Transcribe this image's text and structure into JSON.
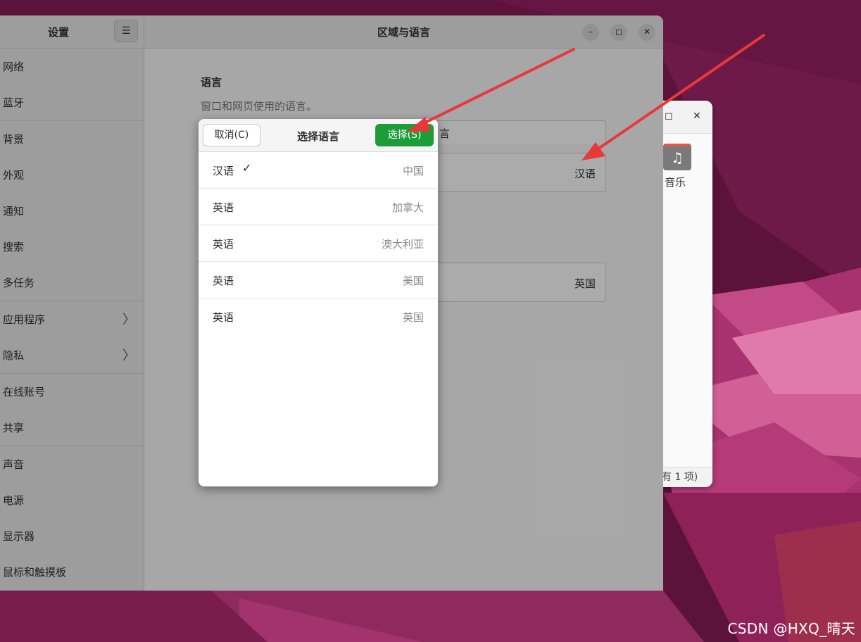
{
  "settings": {
    "sidebar_title": "设置",
    "nav_groups": [
      [
        {
          "label": "网络"
        },
        {
          "label": "蓝牙"
        }
      ],
      [
        {
          "label": "背景"
        },
        {
          "label": "外观"
        },
        {
          "label": "通知"
        },
        {
          "label": "搜索"
        },
        {
          "label": "多任务"
        }
      ],
      [
        {
          "label": "应用程序",
          "chevron": true
        },
        {
          "label": "隐私",
          "chevron": true
        }
      ],
      [
        {
          "label": "在线账号"
        },
        {
          "label": "共享"
        }
      ],
      [
        {
          "label": "声音"
        },
        {
          "label": "电源"
        },
        {
          "label": "显示器"
        },
        {
          "label": "鼠标和触摸板"
        }
      ]
    ],
    "page_title": "区域与语言",
    "language_section": {
      "title": "语言",
      "description": "窗口和网页使用的语言。",
      "partial_row_text": "言",
      "language_value": "汉语"
    },
    "formats_value": "英国",
    "window_buttons": {
      "minimize": "–",
      "maximize": "◻",
      "close": "✕"
    }
  },
  "dialog": {
    "title": "选择语言",
    "cancel_label": "取消(C)",
    "select_label": "选择(S)",
    "languages": [
      {
        "name": "汉语",
        "region": "中国",
        "selected": true
      },
      {
        "name": "英语",
        "region": "加拿大",
        "selected": false
      },
      {
        "name": "英语",
        "region": "澳大利亚",
        "selected": false
      },
      {
        "name": "英语",
        "region": "美国",
        "selected": false
      },
      {
        "name": "英语",
        "region": "英国",
        "selected": false
      }
    ]
  },
  "files_window": {
    "folder_label": "音乐",
    "status": "有 1 项)",
    "maximize": "◻",
    "close": "✕"
  },
  "watermark": "CSDN @HXQ_晴天",
  "colors": {
    "accent_green": "#1c9d3a",
    "annotation_arrow": "#e8383a",
    "wallpaper": "#5a1238"
  }
}
